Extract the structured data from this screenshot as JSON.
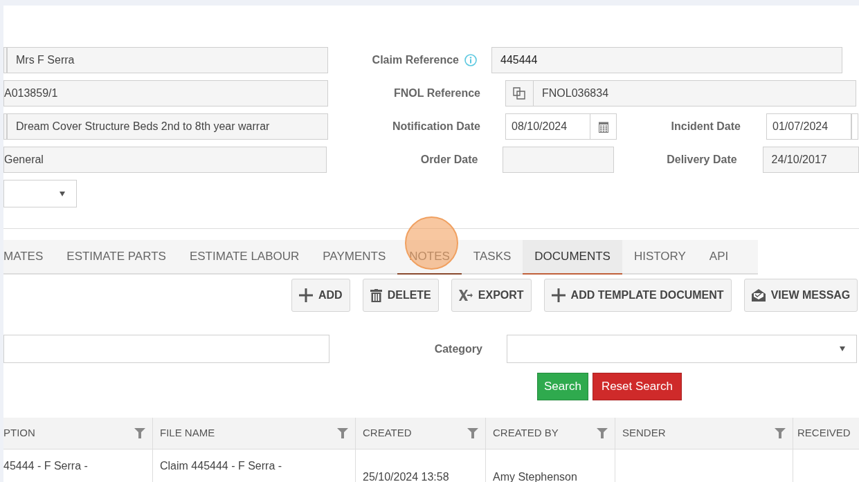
{
  "left_fields": [
    {
      "kind": "prefixed",
      "value": "Mrs F Serra"
    },
    {
      "kind": "plain",
      "value": "A013859/1"
    },
    {
      "kind": "prefixed",
      "value": "Dream Cover Structure Beds 2nd to 8th year warrar"
    },
    {
      "kind": "plain",
      "value": "General"
    },
    {
      "kind": "select"
    }
  ],
  "claim_reference": {
    "label": "Claim Reference",
    "value": "445444"
  },
  "fnol_reference": {
    "label": "FNOL Reference",
    "value": "FNOL036834"
  },
  "notification_date": {
    "label": "Notification Date",
    "value": "08/10/2024"
  },
  "incident_date": {
    "label": "Incident Date",
    "value": "01/07/2024"
  },
  "order_date": {
    "label": "Order Date"
  },
  "delivery_date": {
    "label": "Delivery Date",
    "value": "24/10/2017"
  },
  "tabs": [
    {
      "label": "MATES",
      "selected": false,
      "hovered": false
    },
    {
      "label": "ESTIMATE PARTS",
      "selected": false,
      "hovered": false
    },
    {
      "label": "ESTIMATE LABOUR",
      "selected": false,
      "hovered": false
    },
    {
      "label": "PAYMENTS",
      "selected": false,
      "hovered": false
    },
    {
      "label": "NOTES",
      "selected": false,
      "hovered": true
    },
    {
      "label": "TASKS",
      "selected": false,
      "hovered": false
    },
    {
      "label": "DOCUMENTS",
      "selected": true,
      "hovered": false
    },
    {
      "label": "HISTORY",
      "selected": false,
      "hovered": false
    },
    {
      "label": "API",
      "selected": false,
      "hovered": false
    }
  ],
  "toolbar": [
    {
      "kind": "add",
      "label": "ADD"
    },
    {
      "kind": "delete",
      "label": "DELETE"
    },
    {
      "kind": "export",
      "label": "EXPORT"
    },
    {
      "kind": "add",
      "label": "ADD TEMPLATE DOCUMENT"
    },
    {
      "kind": "message",
      "label": "VIEW MESSAG"
    }
  ],
  "filter": {
    "category_label": "Category",
    "search_button": "Search",
    "reset_button": "Reset Search"
  },
  "table": {
    "columns": [
      "PTION",
      "FILE NAME",
      "CREATED",
      "CREATED BY",
      "SENDER",
      "RECEIVED"
    ],
    "rows": [
      [
        "45444 - F Serra -",
        "Claim 445444 - F Serra -",
        "25/10/2024 13:58",
        "Amy Stephenson",
        "",
        ""
      ]
    ]
  }
}
